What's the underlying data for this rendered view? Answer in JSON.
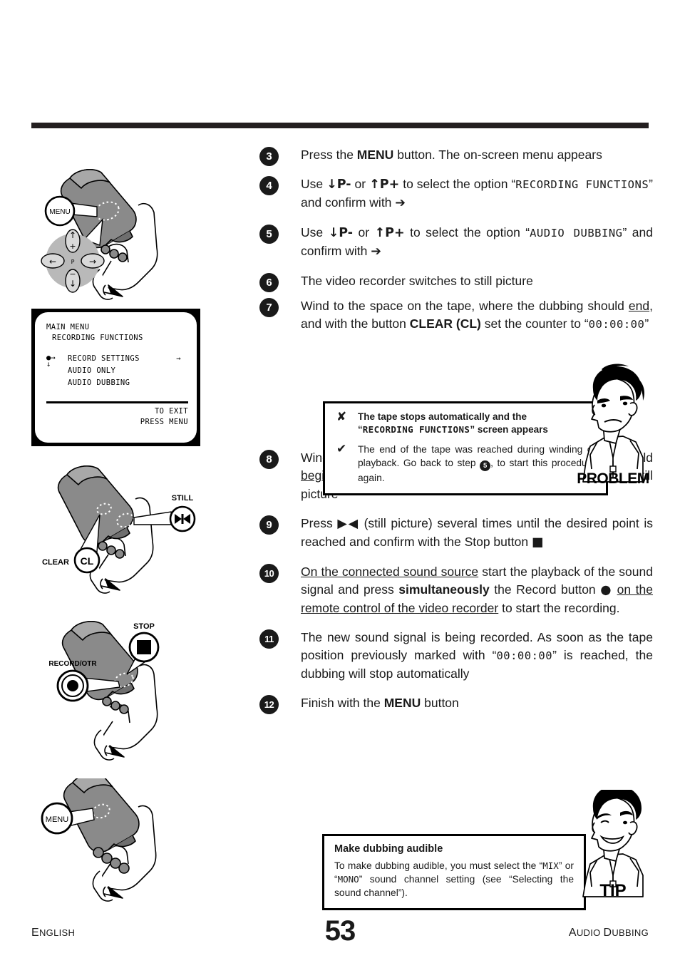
{
  "page": {
    "number": "53",
    "footer_left": "ENGLISH",
    "footer_right": "AUDIO DUBBING"
  },
  "osd": {
    "title": "MAIN MENU",
    "subtitle": "RECORDING FUNCTIONS",
    "marker_selected": "●→",
    "marker_down": "↓",
    "arrow_right": "→",
    "items": [
      {
        "label": "RECORD SETTINGS"
      },
      {
        "label": "AUDIO ONLY"
      },
      {
        "label": "AUDIO DUBBING"
      }
    ],
    "exit_line1": "TO EXIT",
    "exit_line2": "PRESS MENU"
  },
  "illustrations": [
    {
      "name": "remote-menu-top",
      "callouts": [
        {
          "label": "MENU"
        }
      ],
      "dpad": {
        "up": "↑",
        "down": "↓",
        "left": "←",
        "right": "→",
        "plus": "+",
        "minus": "−",
        "center": "P"
      }
    },
    {
      "name": "remote-clear-still",
      "callouts": [
        {
          "label": "CLEAR",
          "button": "CL"
        },
        {
          "label": "STILL",
          "button": "▶◀"
        }
      ]
    },
    {
      "name": "remote-record-stop",
      "callouts": [
        {
          "label": "RECORD/OTR",
          "button": "●"
        },
        {
          "label": "STOP",
          "button": "■"
        }
      ]
    },
    {
      "name": "remote-menu-bottom",
      "callouts": [
        {
          "label": "MENU"
        }
      ]
    }
  ],
  "steps": [
    {
      "num": "3",
      "parts": [
        {
          "t": "Press the ",
          "style": "normal"
        },
        {
          "t": "MENU",
          "style": "bold"
        },
        {
          "t": " button. The on-screen menu appears",
          "style": "normal"
        }
      ]
    },
    {
      "num": "4",
      "parts": [
        {
          "t": "Use ",
          "style": "normal"
        },
        {
          "t": "↓P-",
          "style": "bold"
        },
        {
          "t": " or ",
          "style": "normal"
        },
        {
          "t": "↑P+",
          "style": "bold"
        },
        {
          "t": " to select the option “",
          "style": "normal"
        },
        {
          "t": "RECORDING   FUNCTIONS",
          "style": "mono"
        },
        {
          "t": "” and confirm with ",
          "style": "normal"
        },
        {
          "t": "➔",
          "style": "glyph"
        }
      ]
    },
    {
      "num": "5",
      "parts": [
        {
          "t": "Use ",
          "style": "normal"
        },
        {
          "t": "↓P-",
          "style": "bold"
        },
        {
          "t": " or ",
          "style": "normal"
        },
        {
          "t": "↑P+",
          "style": "bold"
        },
        {
          "t": " to select the option “",
          "style": "normal"
        },
        {
          "t": "AUDIO DUBBING",
          "style": "mono"
        },
        {
          "t": "” and confirm with ",
          "style": "normal"
        },
        {
          "t": "➔",
          "style": "glyph"
        }
      ]
    },
    {
      "num": "6",
      "parts": [
        {
          "t": "The video recorder switches to still picture",
          "style": "normal"
        }
      ]
    },
    {
      "num": "7",
      "parts": [
        {
          "t": "Wind to the space on the tape, where the dubbing should ",
          "style": "normal"
        },
        {
          "t": "end",
          "style": "underline"
        },
        {
          "t": ", and with the button ",
          "style": "normal"
        },
        {
          "t": "CLEAR (CL)",
          "style": "bold"
        },
        {
          "t": " set the counter to “",
          "style": "normal"
        },
        {
          "t": "00:00:00",
          "style": "mono"
        },
        {
          "t": "”",
          "style": "normal"
        }
      ]
    },
    {
      "num": "8",
      "parts": [
        {
          "t": "Wind to the space on the tape, where the dubbing should ",
          "style": "normal"
        },
        {
          "t": "begin",
          "style": "underline"
        },
        {
          "t": ", and press ",
          "style": "normal"
        },
        {
          "t": "▶◀",
          "style": "glyph"
        },
        {
          "t": " . The video recorder switches to still picture",
          "style": "normal"
        }
      ]
    },
    {
      "num": "9",
      "parts": [
        {
          "t": "Press ",
          "style": "normal"
        },
        {
          "t": "▶◀",
          "style": "glyph"
        },
        {
          "t": " (still picture) several times until the desired point is reached and confirm with the Stop button ",
          "style": "normal"
        },
        {
          "t": "■",
          "style": "glyph"
        }
      ]
    },
    {
      "num": "10",
      "parts": [
        {
          "t": "On the connected sound source",
          "style": "underline"
        },
        {
          "t": " start the playback of the sound signal and press ",
          "style": "normal"
        },
        {
          "t": "simultaneously",
          "style": "bold"
        },
        {
          "t": " the Record button ",
          "style": "normal"
        },
        {
          "t": "●",
          "style": "glyph"
        },
        {
          "t": " ",
          "style": "normal"
        },
        {
          "t": "on the remote control of the video recorder",
          "style": "underline"
        },
        {
          "t": " to start the recording.",
          "style": "normal"
        }
      ]
    },
    {
      "num": "11",
      "parts": [
        {
          "t": "The new sound signal is being recorded. As soon as the tape position previously marked with “",
          "style": "normal"
        },
        {
          "t": "00:00:00",
          "style": "mono"
        },
        {
          "t": "” is reached, the dubbing will stop automatically",
          "style": "normal"
        }
      ]
    },
    {
      "num": "12",
      "parts": [
        {
          "t": "Finish with the ",
          "style": "normal"
        },
        {
          "t": "MENU",
          "style": "bold"
        },
        {
          "t": " button",
          "style": "normal"
        }
      ]
    }
  ],
  "problem_box": {
    "label": "PROBLEM",
    "mark_x": "✘",
    "mark_check": "✔",
    "symptom_line1": "The tape stops automatically and the",
    "symptom_mono": "RECORDING FUNCTIONS",
    "symptom_line2_prefix": "“",
    "symptom_line2_suffix": "” screen appears",
    "solution_pre": "The end of the tape was reached during winding or playback. Go back to step ",
    "solution_step": "5",
    "solution_post": ", to start this procedure again."
  },
  "tip_box": {
    "label": "TIP",
    "title": "Make dubbing audible",
    "body_pre": "To make dubbing audible, you must select the “",
    "mono_mix": "MIX",
    "body_mid": "” or “",
    "mono_mono": "MONO",
    "body_post": "” sound channel setting (see “Selecting the sound channel”)."
  },
  "colors": {
    "ink": "#231f20",
    "badge": "#1a1a1a",
    "remote_body": "#8a8a8a",
    "remote_light": "#a8a8a8",
    "remote_dark": "#6e6e6e"
  }
}
